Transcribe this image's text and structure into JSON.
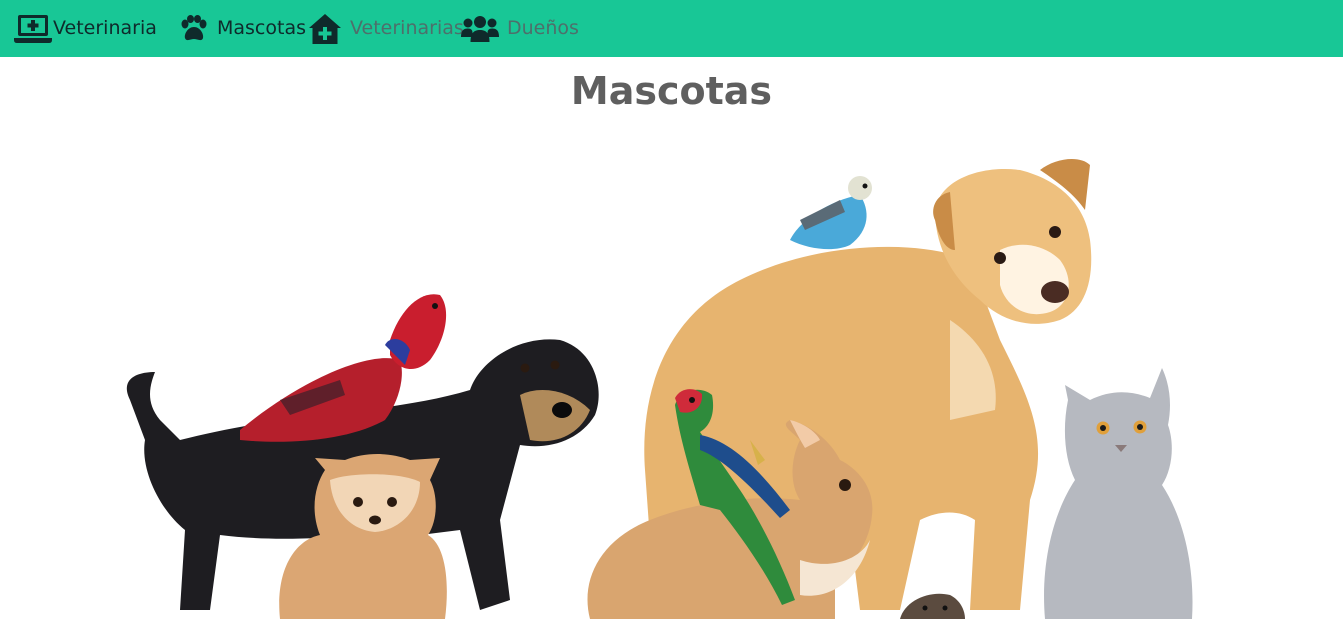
{
  "navbar": {
    "brand": {
      "label": "Veterinaria",
      "icon": "laptop-medical-icon"
    },
    "items": [
      {
        "label": "Mascotas",
        "icon": "paw-icon",
        "active": true
      },
      {
        "label": "Veterinarias",
        "icon": "clinic-icon",
        "active": false
      },
      {
        "label": "Dueños",
        "icon": "users-icon",
        "active": false
      }
    ]
  },
  "main": {
    "title": "Mascotas",
    "hero_image": "pets-group-photo"
  },
  "colors": {
    "navbar_bg": "#18c796",
    "nav_text_active": "#0f2a2b",
    "nav_text_muted": "#4e6f6b",
    "title_color": "#5f5f5f"
  }
}
